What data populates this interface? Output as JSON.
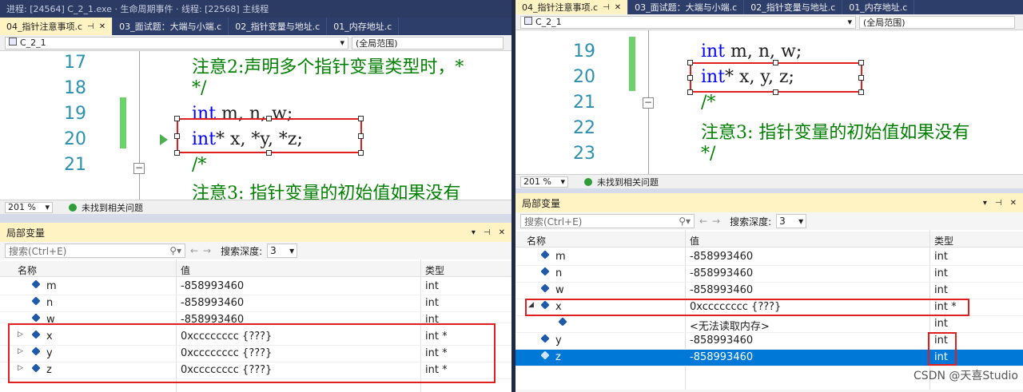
{
  "left": {
    "topstrip": "进程: [24564] C_2_1.exe  ·  生命周期事件 · 线程: [22568] 主线程",
    "tabs": [
      {
        "label": "04_指针注意事项.c",
        "active": true
      },
      {
        "label": "03_面试题：大端与小端.c",
        "active": false
      },
      {
        "label": "02_指针变量与地址.c",
        "active": false
      },
      {
        "label": "01_内存地址.c",
        "active": false
      }
    ],
    "nav_file": "C_2_1",
    "nav_scope": "(全局范围)",
    "code": [
      {
        "n": "17",
        "text": "注意2:声明多个指针变量类型时，*",
        "cls": "cm"
      },
      {
        "n": "18",
        "text": "*/",
        "cls": "cm"
      },
      {
        "n": "19",
        "kw": "int",
        "rest": " m, n, w;"
      },
      {
        "n": "20",
        "kw": "int",
        "rest": "* x, *y, *z;"
      },
      {
        "n": "21",
        "text": "/*",
        "cls": "cm"
      },
      {
        "n": "",
        "text": "注意3: 指针变量的初始值如果没有",
        "cls": "cm"
      }
    ],
    "zoom": "201 %",
    "status": "未找到相关问题",
    "locals_title": "局部变量",
    "search_placeholder": "搜索(Ctrl+E)",
    "depth_label": "搜索深度:",
    "depth_value": "3",
    "headers": {
      "name": "名称",
      "value": "值",
      "type": "类型"
    },
    "rows": [
      {
        "name": "m",
        "value": "-858993460",
        "type": "int",
        "exp": ""
      },
      {
        "name": "n",
        "value": "-858993460",
        "type": "int",
        "exp": ""
      },
      {
        "name": "w",
        "value": "-858993460",
        "type": "int",
        "exp": ""
      },
      {
        "name": "x",
        "value": "0xcccccccc {???}",
        "type": "int *",
        "exp": "▷"
      },
      {
        "name": "y",
        "value": "0xcccccccc {???}",
        "type": "int *",
        "exp": "▷"
      },
      {
        "name": "z",
        "value": "0xcccccccc {???}",
        "type": "int *",
        "exp": "▷"
      }
    ]
  },
  "right": {
    "tabs": [
      {
        "label": "04_指针注意事项.c",
        "active": true
      },
      {
        "label": "03_面试题：大端与小端.c",
        "active": false
      },
      {
        "label": "02_指针变量与地址.c",
        "active": false
      },
      {
        "label": "01_内存地址.c",
        "active": false
      }
    ],
    "nav_file": "C_2_1",
    "nav_scope": "(全局范围)",
    "code": [
      {
        "n": "19",
        "kw": "int",
        "rest": " m, n, w;"
      },
      {
        "n": "20",
        "kw": "int",
        "rest": "* x, y, z;"
      },
      {
        "n": "21",
        "text": "/*",
        "cls": "cm"
      },
      {
        "n": "22",
        "text": "注意3: 指针变量的初始值如果没有",
        "cls": "cm"
      },
      {
        "n": "23",
        "text": "*/",
        "cls": "cm"
      }
    ],
    "zoom": "201 %",
    "status": "未找到相关问题",
    "locals_title": "局部变量",
    "search_placeholder": "搜索(Ctrl+E)",
    "depth_label": "搜索深度:",
    "depth_value": "3",
    "headers": {
      "name": "名称",
      "value": "值",
      "type": "类型"
    },
    "rows": [
      {
        "name": "m",
        "value": "-858993460",
        "type": "int",
        "exp": "",
        "indent": 0
      },
      {
        "name": "n",
        "value": "-858993460",
        "type": "int",
        "exp": "",
        "indent": 0
      },
      {
        "name": "w",
        "value": "-858993460",
        "type": "int",
        "exp": "",
        "indent": 0
      },
      {
        "name": "x",
        "value": "0xcccccccc {???}",
        "type": "int *",
        "exp": "◢",
        "indent": 0
      },
      {
        "name": "",
        "value": "<无法读取内存>",
        "type": "int",
        "exp": "",
        "indent": 1
      },
      {
        "name": "y",
        "value": "-858993460",
        "type": "int",
        "exp": "",
        "indent": 0
      },
      {
        "name": "z",
        "value": "-858993460",
        "type": "int",
        "exp": "",
        "indent": 0,
        "selected": true
      }
    ],
    "watermark": "CSDN @天喜Studio"
  },
  "colors": {
    "accent": "#0078d7",
    "highlight": "#e02020",
    "tab_active": "#fff3c4"
  }
}
